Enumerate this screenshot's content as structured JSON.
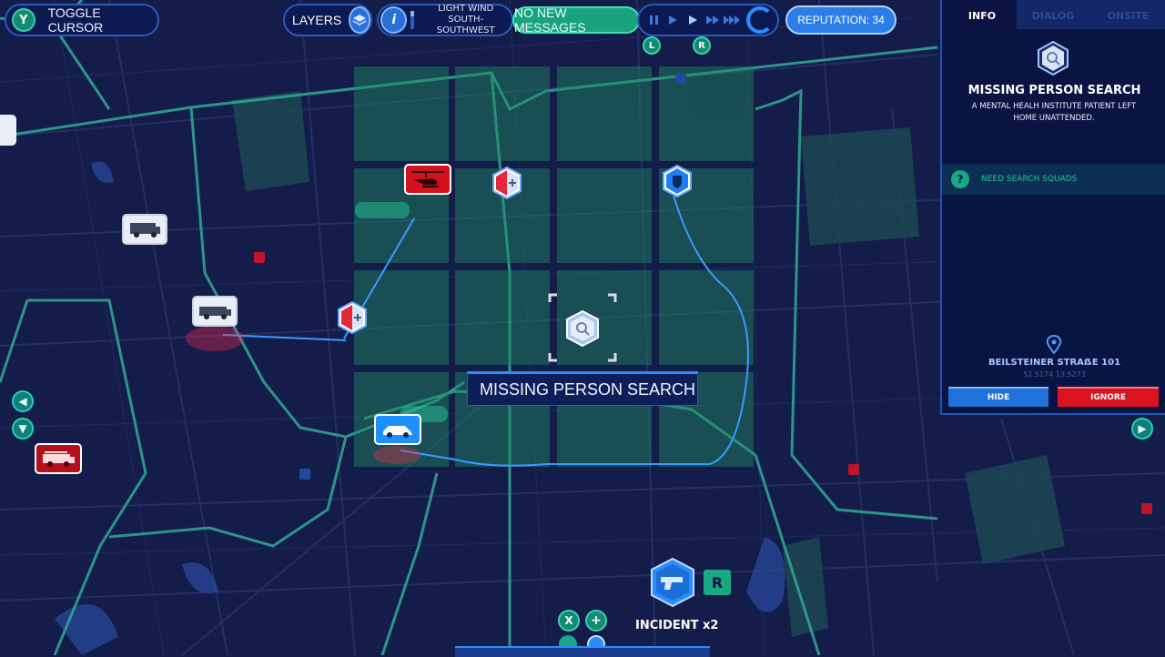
{
  "top_bar": {
    "toggle_button_key": "Y",
    "toggle_label": "TOGGLE CURSOR",
    "layers_label": "LAYERS",
    "wind_line1": "LIGHT WIND",
    "wind_line2": "SOUTH-SOUTHWEST",
    "messages_label": "NO NEW MESSAGES",
    "reputation_label": "REPUTATION: 34",
    "shoulder_left": "L",
    "shoulder_right": "R"
  },
  "panel": {
    "tabs": [
      {
        "label": "INFO",
        "active": true
      },
      {
        "label": "DIALOG",
        "active": false
      },
      {
        "label": "ONSITE",
        "active": false
      }
    ],
    "title": "MISSING PERSON SEARCH",
    "description": "A MENTAL HEALH INSTITUTE PATIENT LEFT HOME UNATTENDED.",
    "requirement_icon": "?",
    "requirement": "NEED SEARCH SQUADS",
    "address": "BEILSTEINER STRAẞE 101",
    "coords": "52.5174 13.5273",
    "hide_label": "HIDE",
    "ignore_label": "IGNORE"
  },
  "map": {
    "incident_label": "MISSING PERSON SEARCH",
    "bottom_incident": "INCIDENT x2",
    "bottom_key": "R",
    "bottom_x": "X",
    "bottom_plus": "+"
  },
  "colors": {
    "map_bg": "#141d4a",
    "roads": "#2ea48f",
    "accent_blue": "#2b8cff",
    "alert_red": "#e01a2a",
    "teal_button": "#1aa883"
  },
  "icons": [
    "search-icon",
    "police-shield-icon",
    "medical-icon",
    "helicopter-icon",
    "ambulance-icon",
    "police-car-icon",
    "fire-truck-icon",
    "pistol-icon",
    "location-pin-icon",
    "layers-icon",
    "info-icon"
  ]
}
